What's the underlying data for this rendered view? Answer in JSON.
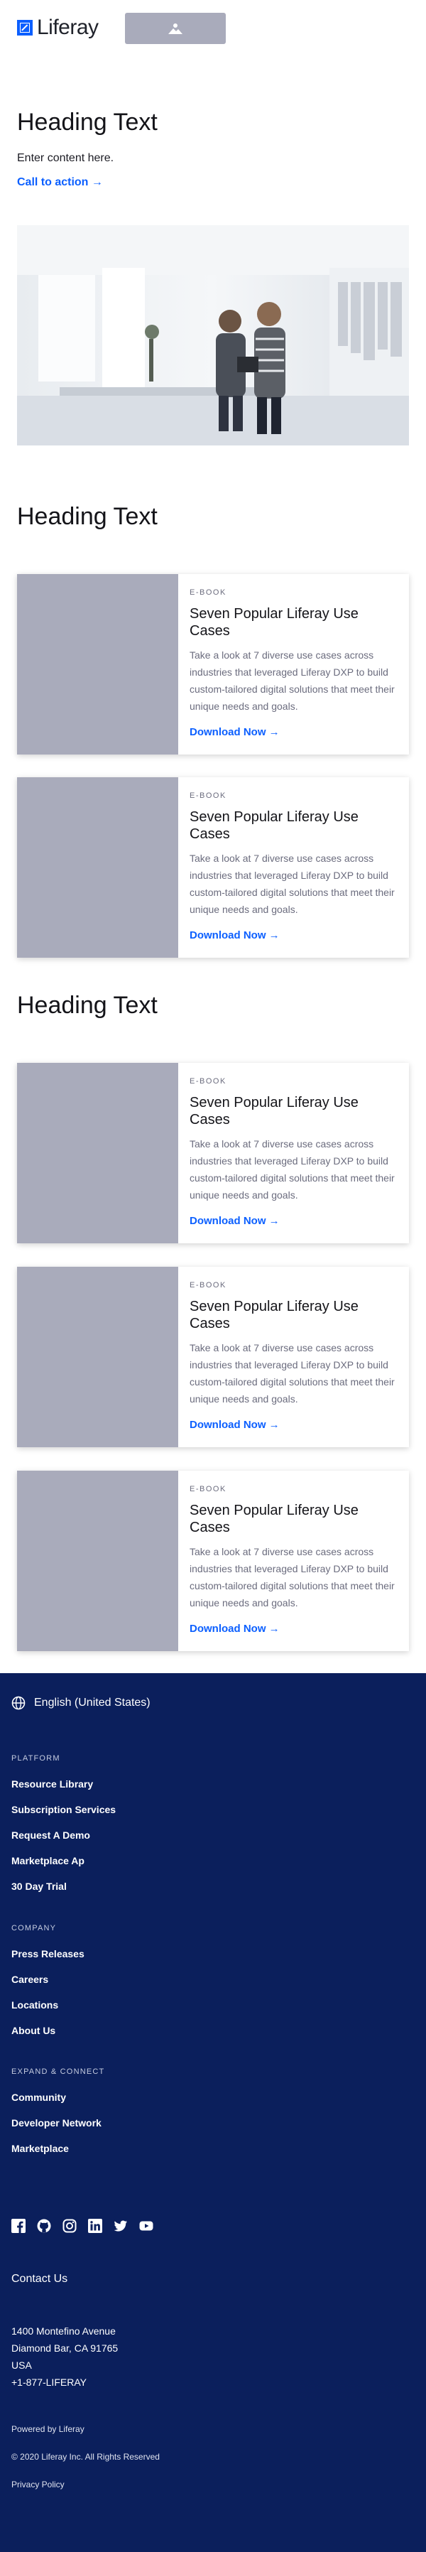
{
  "header": {
    "logo_text": "Liferay",
    "image_placeholder_icon": "image-icon"
  },
  "hero": {
    "heading": "Heading Text",
    "body": "Enter content here.",
    "cta": "Call to action →"
  },
  "section1": {
    "heading": "Heading Text"
  },
  "section2": {
    "heading": "Heading Text"
  },
  "cards": [
    {
      "eyebrow": "E-BOOK",
      "title": "Seven Popular Liferay Use Cases",
      "text": "Take a look at 7 diverse use cases across industries that leveraged Liferay DXP to build custom-tailored digital solutions that meet their unique needs and goals.",
      "link": "Download Now →"
    },
    {
      "eyebrow": "E-BOOK",
      "title": "Seven Popular Liferay Use Cases",
      "text": "Take a look at 7 diverse use cases across industries that leveraged Liferay DXP to build custom-tailored digital solutions that meet their unique needs and goals.",
      "link": "Download Now →"
    },
    {
      "eyebrow": "E-BOOK",
      "title": "Seven Popular Liferay Use Cases",
      "text": "Take a look at 7 diverse use cases across industries that leveraged Liferay DXP to build custom-tailored digital solutions that meet their unique needs and goals.",
      "link": "Download Now →"
    },
    {
      "eyebrow": "E-BOOK",
      "title": "Seven Popular Liferay Use Cases",
      "text": "Take a look at 7 diverse use cases across industries that leveraged Liferay DXP to build custom-tailored digital solutions that meet their unique needs and goals.",
      "link": "Download Now →"
    },
    {
      "eyebrow": "E-BOOK",
      "title": "Seven Popular Liferay Use Cases",
      "text": "Take a look at 7 diverse use cases across industries that leveraged Liferay DXP to build custom-tailored digital solutions that meet their unique needs and goals.",
      "link": "Download Now →"
    }
  ],
  "footer": {
    "language": "English (United States)",
    "platform": {
      "heading": "PLATFORM",
      "items": [
        "Resource Library",
        "Subscription Services",
        "Request A Demo",
        "Marketplace Ap",
        "30 Day Trial"
      ]
    },
    "company": {
      "heading": "COMPANY",
      "items": [
        "Press Releases",
        "Careers",
        "Locations",
        "About Us"
      ]
    },
    "connect": {
      "heading": "EXPAND & CONNECT",
      "items": [
        "Community",
        "Developer Network",
        "Marketplace"
      ]
    },
    "social_icons": [
      "facebook-icon",
      "github-icon",
      "instagram-icon",
      "linkedin-icon",
      "twitter-icon",
      "youtube-icon"
    ],
    "contact_heading": "Contact Us",
    "address": [
      "1400 Montefino Avenue",
      "Diamond Bar, CA 91765",
      "USA",
      "+1-877-LIFERAY"
    ],
    "powered_by": "Powered by Liferay",
    "copyright": "© 2020 Liferay Inc. All Rights Reserved",
    "privacy": "Privacy Policy"
  },
  "colors": {
    "accent": "#0b5fff",
    "footer_bg": "#0b1f5c",
    "placeholder": "#a9abbb"
  }
}
